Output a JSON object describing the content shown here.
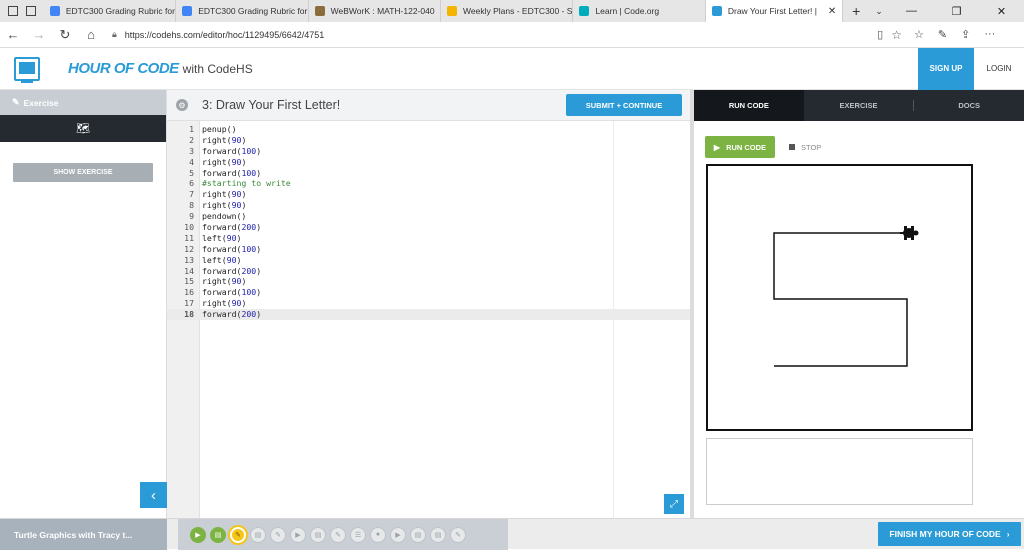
{
  "browser": {
    "tabs": [
      {
        "title": "EDTC300 Grading Rubric for",
        "icon": "docs-icon",
        "color": "#4285f4"
      },
      {
        "title": "EDTC300 Grading Rubric for",
        "icon": "docs-icon",
        "color": "#4285f4"
      },
      {
        "title": "WeBWorK : MATH-122-040",
        "icon": "webwork-icon",
        "color": "#8a6d3b"
      },
      {
        "title": "Weekly Plans - EDTC300 - S",
        "icon": "drive-icon",
        "color": "#f4b400"
      },
      {
        "title": "Learn | Code.org",
        "icon": "codeorg-icon",
        "color": "#00adbc"
      },
      {
        "title": "Draw Your First Letter! |",
        "icon": "codehs-icon",
        "color": "#2a9bd6"
      }
    ],
    "url": "https://codehs.com/editor/hoc/1129495/6642/4751"
  },
  "header": {
    "brand": "HOUR OF CODE",
    "brand_suffix": "with CodeHS",
    "signup_label": "SIGN UP",
    "login_label": "LOGIN",
    "accent": "#2a9bd6"
  },
  "sidebar": {
    "section_label": "Exercise",
    "show_exercise_label": "SHOW EXERCISE"
  },
  "editor": {
    "title": "3: Draw Your First Letter!",
    "submit_label": "SUBMIT + CONTINUE",
    "current_line": 18,
    "code_lines": [
      "penup()",
      "right(90)",
      "forward(100)",
      "right(90)",
      "forward(100)",
      "#starting to write",
      "right(90)",
      "right(90)",
      "pendown()",
      "forward(200)",
      "left(90)",
      "forward(100)",
      "left(90)",
      "forward(200)",
      "right(90)",
      "forward(100)",
      "right(90)",
      "forward(200)"
    ]
  },
  "right_panel": {
    "tabs": [
      "RUN CODE",
      "EXERCISE",
      "DOCS"
    ],
    "run_label": "RUN CODE",
    "stop_label": "STOP"
  },
  "bottom": {
    "lesson_title": "Turtle Graphics with Tracy t...",
    "finish_label": "FINISH MY HOUR OF CODE",
    "lesson_icons": [
      "video-icon",
      "doc-icon",
      "pencil-icon",
      "doc-icon",
      "pencil-icon",
      "video-icon",
      "doc-icon",
      "pencil-icon",
      "list-icon",
      "dot-icon",
      "video-icon",
      "doc-icon",
      "doc-icon",
      "pencil-icon"
    ],
    "done_count": 2,
    "current_index": 2
  }
}
